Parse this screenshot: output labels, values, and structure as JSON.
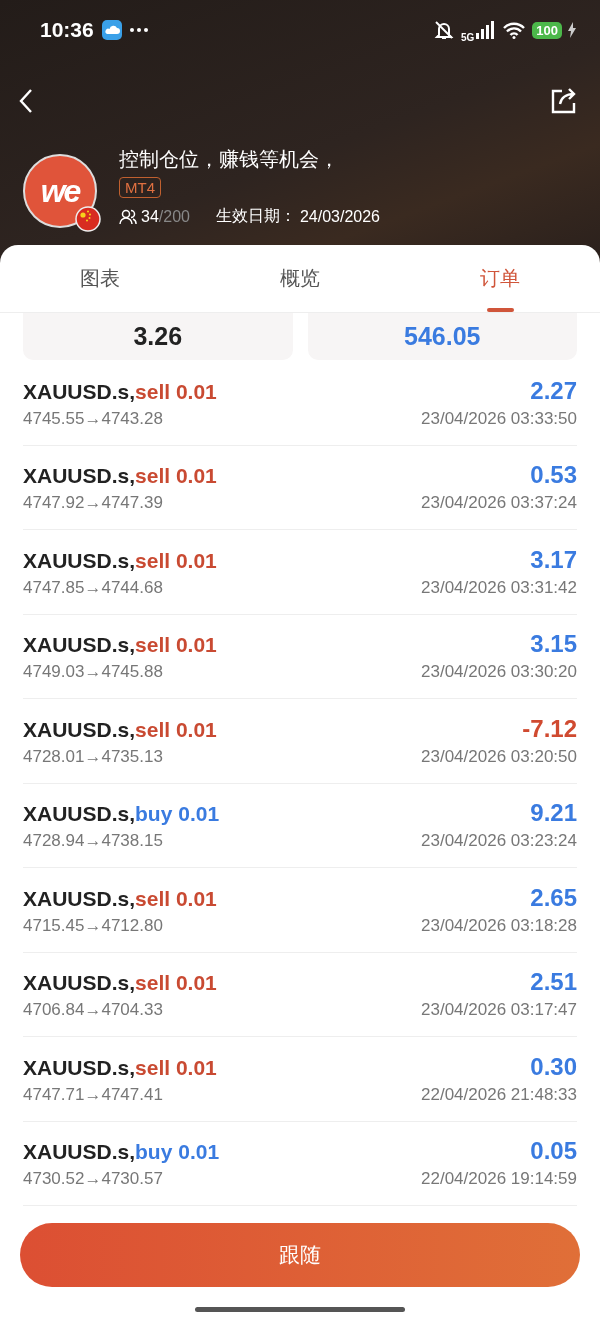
{
  "status_bar": {
    "time": "10:36",
    "network": "5G",
    "battery": "100"
  },
  "header": {
    "avatar": {
      "logo_text": "we"
    },
    "title": "控制仓位，赚钱等机会，",
    "platform_badge": "MT4",
    "followers": "34",
    "follower_limit": "/200",
    "effective_label": "生效日期：",
    "effective_date": "24/03/2026"
  },
  "tabs": [
    {
      "label": "图表",
      "selected": false
    },
    {
      "label": "概览",
      "selected": false
    },
    {
      "label": "订单",
      "selected": true
    }
  ],
  "summary_cards": [
    {
      "value": "3.26",
      "kind": "neutral"
    },
    {
      "value": "546.05",
      "kind": "positive"
    }
  ],
  "orders": [
    {
      "symbol": "XAUUSD.s,",
      "side": "sell 0.01",
      "kind": "sell",
      "prices": "4745.55→4743.28",
      "profit": "2.27",
      "negative": false,
      "time": "23/04/2026 03:33:50"
    },
    {
      "symbol": "XAUUSD.s,",
      "side": "sell 0.01",
      "kind": "sell",
      "prices": "4747.92→4747.39",
      "profit": "0.53",
      "negative": false,
      "time": "23/04/2026 03:37:24"
    },
    {
      "symbol": "XAUUSD.s,",
      "side": "sell 0.01",
      "kind": "sell",
      "prices": "4747.85→4744.68",
      "profit": "3.17",
      "negative": false,
      "time": "23/04/2026 03:31:42"
    },
    {
      "symbol": "XAUUSD.s,",
      "side": "sell 0.01",
      "kind": "sell",
      "prices": "4749.03→4745.88",
      "profit": "3.15",
      "negative": false,
      "time": "23/04/2026 03:30:20"
    },
    {
      "symbol": "XAUUSD.s,",
      "side": "sell 0.01",
      "kind": "sell",
      "prices": "4728.01→4735.13",
      "profit": "-7.12",
      "negative": true,
      "time": "23/04/2026 03:20:50"
    },
    {
      "symbol": "XAUUSD.s,",
      "side": "buy 0.01",
      "kind": "buy",
      "prices": "4728.94→4738.15",
      "profit": "9.21",
      "negative": false,
      "time": "23/04/2026 03:23:24"
    },
    {
      "symbol": "XAUUSD.s,",
      "side": "sell 0.01",
      "kind": "sell",
      "prices": "4715.45→4712.80",
      "profit": "2.65",
      "negative": false,
      "time": "23/04/2026 03:18:28"
    },
    {
      "symbol": "XAUUSD.s,",
      "side": "sell 0.01",
      "kind": "sell",
      "prices": "4706.84→4704.33",
      "profit": "2.51",
      "negative": false,
      "time": "23/04/2026 03:17:47"
    },
    {
      "symbol": "XAUUSD.s,",
      "side": "sell 0.01",
      "kind": "sell",
      "prices": "4747.71→4747.41",
      "profit": "0.30",
      "negative": false,
      "time": "22/04/2026 21:48:33"
    },
    {
      "symbol": "XAUUSD.s,",
      "side": "buy 0.01",
      "kind": "buy",
      "prices": "4730.52→4730.57",
      "profit": "0.05",
      "negative": false,
      "time": "22/04/2026 19:14:59"
    }
  ],
  "follow_button": "跟随"
}
